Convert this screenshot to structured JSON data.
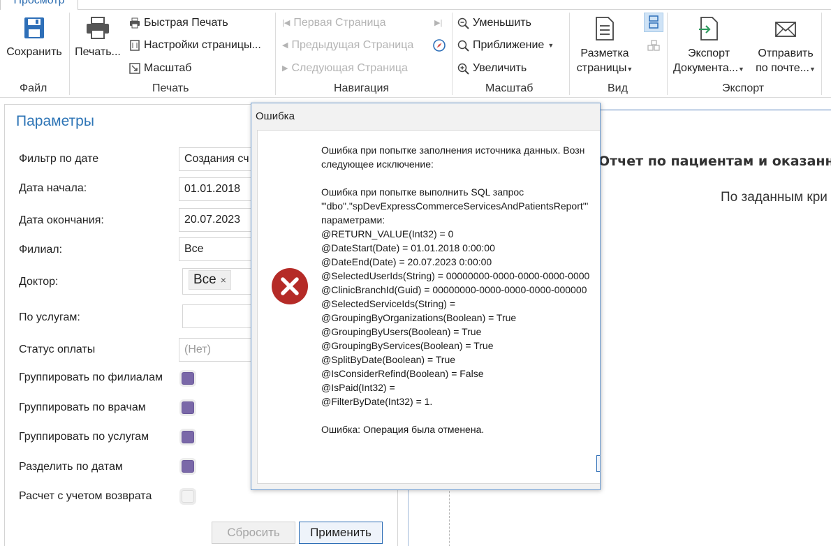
{
  "ribbon": {
    "active_tab": "Просмотр",
    "groups": {
      "file": "Файл",
      "print": "Печать",
      "navigation": "Навигация",
      "zoom": "Масштаб",
      "view": "Вид",
      "export": "Экспорт"
    },
    "buttons": {
      "save": "Сохранить",
      "print": "Печать...",
      "quick_print": "Быстрая Печать",
      "page_setup": "Настройки страницы...",
      "scale": "Масштаб",
      "first_page": "Первая Страница",
      "prev_page": "Предыдущая Страница",
      "next_page": "Следующая Страница",
      "zoom_out": "Уменьшить",
      "zoom": "Приближение",
      "zoom_in": "Увеличить",
      "page_layout_1": "Разметка",
      "page_layout_2": "страницы",
      "export_doc_1": "Экспорт",
      "export_doc_2": "Документа...",
      "send_mail_1": "Отправить",
      "send_mail_2": "по почте..."
    }
  },
  "params": {
    "title": "Параметры",
    "date_filter": {
      "label": "Фильтр по дате",
      "value": "Создания сч"
    },
    "start_date": {
      "label": "Дата начала:",
      "value": "01.01.2018"
    },
    "end_date": {
      "label": "Дата окончания:",
      "value": "20.07.2023"
    },
    "branch": {
      "label": "Филиал:",
      "value": "Все"
    },
    "doctor": {
      "label": "Доктор:",
      "chip": "Все",
      "chip_remove": "×"
    },
    "services": {
      "label": "По услугам:",
      "value": ""
    },
    "payment_status": {
      "label": "Статус оплаты",
      "placeholder": "(Нет)"
    },
    "group_by_branches": {
      "label": "Группировать по филиалам",
      "checked": true
    },
    "group_by_doctors": {
      "label": "Группировать по врачам",
      "checked": true
    },
    "group_by_services": {
      "label": "Группировать по услугам",
      "checked": true
    },
    "split_by_dates": {
      "label": "Разделить по датам",
      "checked": true
    },
    "consider_refund": {
      "label": "Расчет с учетом возврата",
      "checked": false
    },
    "reset_label": "Сбросить",
    "apply_label": "Применить"
  },
  "report": {
    "title": "Отчет по пациентам и оказанны",
    "subtitle": "По заданным кри"
  },
  "dialog": {
    "title": "Ошибка",
    "lines": [
      "Ошибка при попытке заполнения источника данных. Возн",
      "следующее исключение:",
      "",
      "Ошибка при попытке выполнить SQL запрос",
      "'\"dbo\".\"spDevExpressCommerceServicesAndPatientsReport\"'",
      "параметрами:",
      "@RETURN_VALUE(Int32) = 0",
      "@DateStart(Date) = 01.01.2018 0:00:00",
      "@DateEnd(Date) = 20.07.2023 0:00:00",
      "@SelectedUserIds(String) = 00000000-0000-0000-0000-0000",
      "@ClinicBranchId(Guid) = 00000000-0000-0000-0000-000000",
      "@SelectedServiceIds(String) =",
      "@GroupingByOrganizations(Boolean) = True",
      "@GroupingByUsers(Boolean) = True",
      "@GroupingByServices(Boolean) = True",
      "@SplitByDate(Boolean) = True",
      "@IsConsiderRefind(Boolean) = False",
      "@IsPaid(Int32) =",
      "@FilterByDate(Int32) = 1.",
      "",
      "Ошибка: Операция была отменена."
    ]
  }
}
